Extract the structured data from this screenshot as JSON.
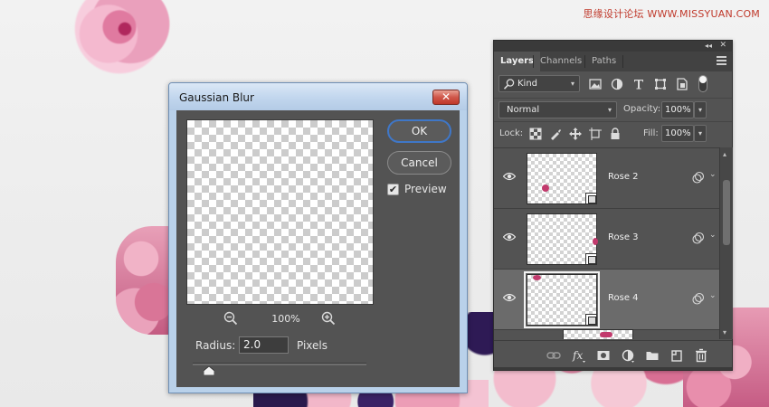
{
  "watermark": {
    "text": "思缘设计论坛  WWW.MISSYUAN.COM"
  },
  "colors": {
    "accent_ok_border": "#3f77c8",
    "dialog_frame": "#b9d1ea",
    "panel_bg": "#535353",
    "close_button": "#c0392b"
  },
  "dialog": {
    "title": "Gaussian Blur",
    "close_icon": "close-icon",
    "ok_label": "OK",
    "cancel_label": "Cancel",
    "preview": {
      "label": "Preview",
      "checked": true,
      "checkmark": "✔"
    },
    "zoom": {
      "value": "100%",
      "zoom_out_icon": "zoom-out-icon",
      "zoom_in_icon": "zoom-in-icon"
    },
    "radius": {
      "label": "Radius:",
      "value": "2.0",
      "unit": "Pixels"
    }
  },
  "layers_panel": {
    "tabs": [
      {
        "label": "Layers",
        "active": true
      },
      {
        "label": "Channels",
        "active": false
      },
      {
        "label": "Paths",
        "active": false
      }
    ],
    "collapse_glyph": "◂◂",
    "close_glyph": "✕",
    "filter": {
      "kind_label": "Kind",
      "icons": [
        "image-filter-icon",
        "adjustment-filter-icon",
        "type-filter-icon",
        "shape-filter-icon",
        "smart-object-filter-icon"
      ]
    },
    "blend_mode": "Normal",
    "opacity": {
      "label": "Opacity:",
      "value": "100%"
    },
    "lock": {
      "label": "Lock:",
      "icons": [
        "lock-transparent-pixels-icon",
        "lock-image-pixels-icon",
        "lock-position-icon",
        "lock-artboard-icon",
        "lock-all-icon"
      ]
    },
    "fill": {
      "label": "Fill:",
      "value": "100%"
    },
    "caret_glyph": "▾",
    "row_chevron_glyph": "⌄",
    "layers": [
      {
        "name": "Rose 2",
        "visible": true,
        "selected": false,
        "smart_object": true
      },
      {
        "name": "Rose 3",
        "visible": true,
        "selected": false,
        "smart_object": true
      },
      {
        "name": "Rose 4",
        "visible": true,
        "selected": true,
        "smart_object": true
      }
    ],
    "scroll_up_glyph": "▴",
    "scroll_down_glyph": "▾",
    "bottom_icons": [
      "link-layers-icon",
      "fx-icon",
      "add-mask-icon",
      "adjustment-layer-icon",
      "new-group-icon",
      "new-layer-icon",
      "delete-layer-icon"
    ]
  }
}
